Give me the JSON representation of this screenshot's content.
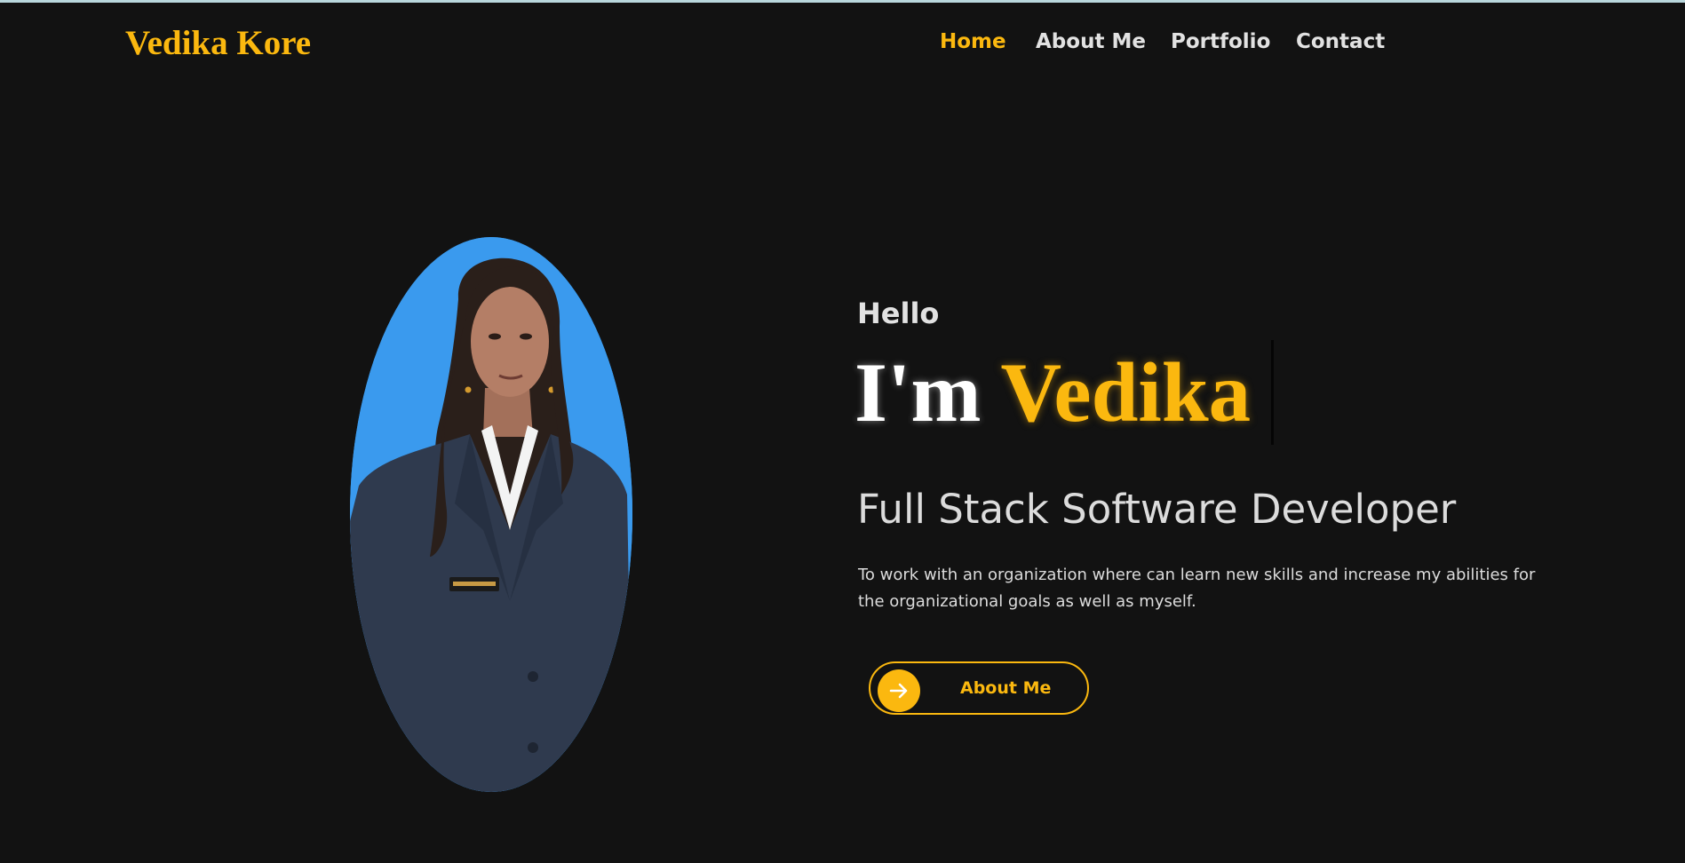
{
  "header": {
    "brand": "Vedika Kore",
    "nav": [
      {
        "label": "Home",
        "active": true
      },
      {
        "label": "About Me",
        "active": false
      },
      {
        "label": "Portfolio",
        "active": false
      },
      {
        "label": "Contact",
        "active": false
      }
    ]
  },
  "hero": {
    "greeting": "Hello",
    "intro": "I'm",
    "name": "Vedika",
    "role": "Full Stack Software Developer",
    "objective": "To work with an organization where can learn new skills and increase my abilities for the organizational goals as well as myself.",
    "cta_label": "About Me",
    "cta_icon": "arrow-right-icon",
    "photo_icon": "profile-photo"
  },
  "colors": {
    "accent": "#fbb80f",
    "background": "#121212",
    "text": "#e2e2e2",
    "photo_background": "#3a9aee"
  }
}
